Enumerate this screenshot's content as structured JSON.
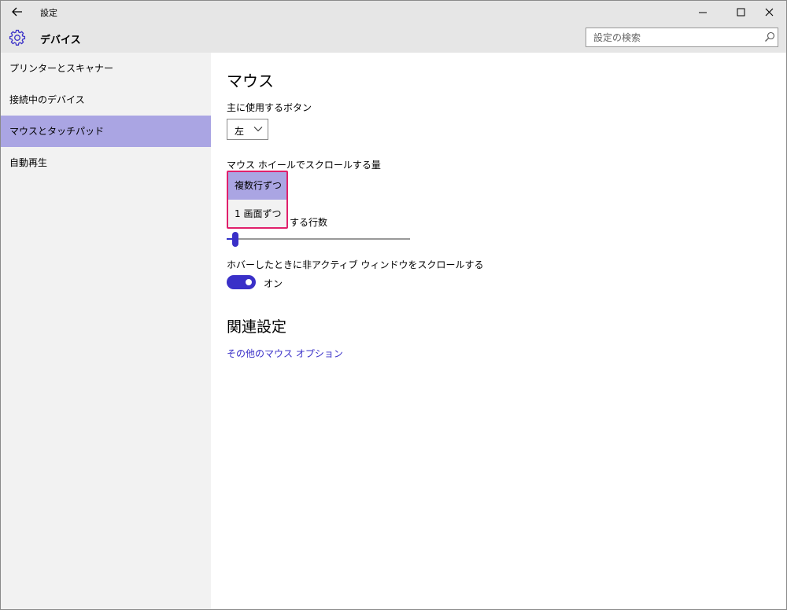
{
  "window": {
    "title": "設定",
    "icons": {
      "back": "back-arrow-icon",
      "minimize": "minimize-icon",
      "maximize": "maximize-icon",
      "close": "close-icon"
    }
  },
  "header": {
    "title": "デバイス",
    "icon": "gear-icon",
    "search_placeholder": "設定の検索",
    "search_icon": "search-icon"
  },
  "sidebar": {
    "items": [
      {
        "label": "プリンターとスキャナー",
        "active": false
      },
      {
        "label": "接続中のデバイス",
        "active": false
      },
      {
        "label": "マウスとタッチパッド",
        "active": true
      },
      {
        "label": "自動再生",
        "active": false
      }
    ]
  },
  "main": {
    "title": "マウス",
    "primary_button": {
      "label": "主に使用するボタン",
      "value": "左"
    },
    "wheel": {
      "label": "マウス ホイールでスクロールする量",
      "options": [
        "複数行ずつ",
        "1 画面ずつ"
      ],
      "selected": "複数行ずつ"
    },
    "lines_label_visible": "する行数",
    "lines_slider_level": 0.03,
    "inactive_scroll": {
      "label": "ホバーしたときに非アクティブ ウィンドウをスクロールする",
      "state_label": "オン",
      "on": true
    },
    "related": {
      "title": "関連設定",
      "link": "その他のマウス オプション"
    }
  },
  "colors": {
    "accent": "#3a30c8",
    "selection": "#aaa5e3",
    "highlight_border": "#e0206b",
    "chrome": "#e6e6e6",
    "sidebar_bg": "#f2f2f2"
  }
}
